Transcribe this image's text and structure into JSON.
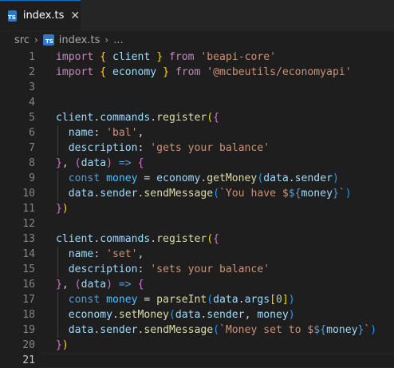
{
  "tab": {
    "icon_text": "TS",
    "label": "index.ts",
    "close": "✕"
  },
  "breadcrumb": {
    "folder": "src",
    "sep1": "›",
    "icon_text": "TS",
    "file": "index.ts",
    "sep2": "›",
    "more": "..."
  },
  "lines": [
    {
      "n": "1",
      "tokens": [
        [
          "k",
          "import"
        ],
        [
          "t",
          " "
        ],
        [
          "b1",
          "{"
        ],
        [
          "t",
          " "
        ],
        [
          "v",
          "client"
        ],
        [
          "t",
          " "
        ],
        [
          "b1",
          "}"
        ],
        [
          "t",
          " "
        ],
        [
          "k",
          "from"
        ],
        [
          "t",
          " "
        ],
        [
          "s",
          "'beapi-core'"
        ]
      ]
    },
    {
      "n": "2",
      "tokens": [
        [
          "k",
          "import"
        ],
        [
          "t",
          " "
        ],
        [
          "b1",
          "{"
        ],
        [
          "t",
          " "
        ],
        [
          "v",
          "economy"
        ],
        [
          "t",
          " "
        ],
        [
          "b1",
          "}"
        ],
        [
          "t",
          " "
        ],
        [
          "k",
          "from"
        ],
        [
          "t",
          " "
        ],
        [
          "s",
          "'@mcbeutils/economyapi'"
        ]
      ]
    },
    {
      "n": "3",
      "tokens": []
    },
    {
      "n": "4",
      "tokens": []
    },
    {
      "n": "5",
      "tokens": [
        [
          "v",
          "client"
        ],
        [
          "t",
          "."
        ],
        [
          "v",
          "commands"
        ],
        [
          "t",
          "."
        ],
        [
          "f",
          "register"
        ],
        [
          "b1",
          "("
        ],
        [
          "b2",
          "{"
        ]
      ]
    },
    {
      "n": "6",
      "tokens": [
        [
          "t",
          "  "
        ],
        [
          "v",
          "name"
        ],
        [
          "t",
          ": "
        ],
        [
          "s",
          "'bal'"
        ],
        [
          "t",
          ","
        ]
      ]
    },
    {
      "n": "7",
      "tokens": [
        [
          "t",
          "  "
        ],
        [
          "v",
          "description"
        ],
        [
          "t",
          ": "
        ],
        [
          "s",
          "'gets your balance'"
        ]
      ]
    },
    {
      "n": "8",
      "tokens": [
        [
          "b2",
          "}"
        ],
        [
          "t",
          ", "
        ],
        [
          "b2",
          "("
        ],
        [
          "v",
          "data"
        ],
        [
          "b2",
          ")"
        ],
        [
          "t",
          " "
        ],
        [
          "kw",
          "=>"
        ],
        [
          "t",
          " "
        ],
        [
          "b2",
          "{"
        ]
      ]
    },
    {
      "n": "9",
      "tokens": [
        [
          "t",
          "  "
        ],
        [
          "kw",
          "const"
        ],
        [
          "t",
          " "
        ],
        [
          "c",
          "money"
        ],
        [
          "t",
          " = "
        ],
        [
          "v",
          "economy"
        ],
        [
          "t",
          "."
        ],
        [
          "f",
          "getMoney"
        ],
        [
          "b3",
          "("
        ],
        [
          "v",
          "data"
        ],
        [
          "t",
          "."
        ],
        [
          "v",
          "sender"
        ],
        [
          "b3",
          ")"
        ]
      ]
    },
    {
      "n": "10",
      "tokens": [
        [
          "t",
          "  "
        ],
        [
          "v",
          "data"
        ],
        [
          "t",
          "."
        ],
        [
          "v",
          "sender"
        ],
        [
          "t",
          "."
        ],
        [
          "f",
          "sendMessage"
        ],
        [
          "b3",
          "("
        ],
        [
          "s",
          "`You have $"
        ],
        [
          "e",
          "${"
        ],
        [
          "vs",
          "money"
        ],
        [
          "e",
          "}"
        ],
        [
          "s",
          "`"
        ],
        [
          "b3",
          ")"
        ]
      ]
    },
    {
      "n": "11",
      "tokens": [
        [
          "b2",
          "}"
        ],
        [
          "b1",
          ")"
        ]
      ]
    },
    {
      "n": "12",
      "tokens": []
    },
    {
      "n": "13",
      "tokens": [
        [
          "v",
          "client"
        ],
        [
          "t",
          "."
        ],
        [
          "v",
          "commands"
        ],
        [
          "t",
          "."
        ],
        [
          "f",
          "register"
        ],
        [
          "b1",
          "("
        ],
        [
          "b2",
          "{"
        ]
      ]
    },
    {
      "n": "14",
      "tokens": [
        [
          "t",
          "  "
        ],
        [
          "v",
          "name"
        ],
        [
          "t",
          ": "
        ],
        [
          "s",
          "'set'"
        ],
        [
          "t",
          ","
        ]
      ]
    },
    {
      "n": "15",
      "tokens": [
        [
          "t",
          "  "
        ],
        [
          "v",
          "description"
        ],
        [
          "t",
          ": "
        ],
        [
          "s",
          "'sets your balance'"
        ]
      ]
    },
    {
      "n": "16",
      "tokens": [
        [
          "b2",
          "}"
        ],
        [
          "t",
          ", "
        ],
        [
          "b2",
          "("
        ],
        [
          "v",
          "data"
        ],
        [
          "b2",
          ")"
        ],
        [
          "t",
          " "
        ],
        [
          "kw",
          "=>"
        ],
        [
          "t",
          " "
        ],
        [
          "b2",
          "{"
        ]
      ]
    },
    {
      "n": "17",
      "tokens": [
        [
          "t",
          "  "
        ],
        [
          "kw",
          "const"
        ],
        [
          "t",
          " "
        ],
        [
          "c",
          "money"
        ],
        [
          "t",
          " = "
        ],
        [
          "f",
          "parseInt"
        ],
        [
          "b3",
          "("
        ],
        [
          "v",
          "data"
        ],
        [
          "t",
          "."
        ],
        [
          "v",
          "args"
        ],
        [
          "b1",
          "["
        ],
        [
          "n",
          "0"
        ],
        [
          "b1",
          "]"
        ],
        [
          "b3",
          ")"
        ]
      ]
    },
    {
      "n": "18",
      "tokens": [
        [
          "t",
          "  "
        ],
        [
          "v",
          "economy"
        ],
        [
          "t",
          "."
        ],
        [
          "f",
          "setMoney"
        ],
        [
          "b3",
          "("
        ],
        [
          "v",
          "data"
        ],
        [
          "t",
          "."
        ],
        [
          "v",
          "sender"
        ],
        [
          "t",
          ", "
        ],
        [
          "v",
          "money"
        ],
        [
          "b3",
          ")"
        ]
      ]
    },
    {
      "n": "19",
      "tokens": [
        [
          "t",
          "  "
        ],
        [
          "v",
          "data"
        ],
        [
          "t",
          "."
        ],
        [
          "v",
          "sender"
        ],
        [
          "t",
          "."
        ],
        [
          "f",
          "sendMessage"
        ],
        [
          "b3",
          "("
        ],
        [
          "s",
          "`Money set to $"
        ],
        [
          "e",
          "${"
        ],
        [
          "vs",
          "money"
        ],
        [
          "e",
          "}"
        ],
        [
          "s",
          "`"
        ],
        [
          "b3",
          ")"
        ]
      ]
    },
    {
      "n": "20",
      "tokens": [
        [
          "b2",
          "}"
        ],
        [
          "b1",
          ")"
        ]
      ]
    },
    {
      "n": "21",
      "tokens": [],
      "current": true
    }
  ]
}
